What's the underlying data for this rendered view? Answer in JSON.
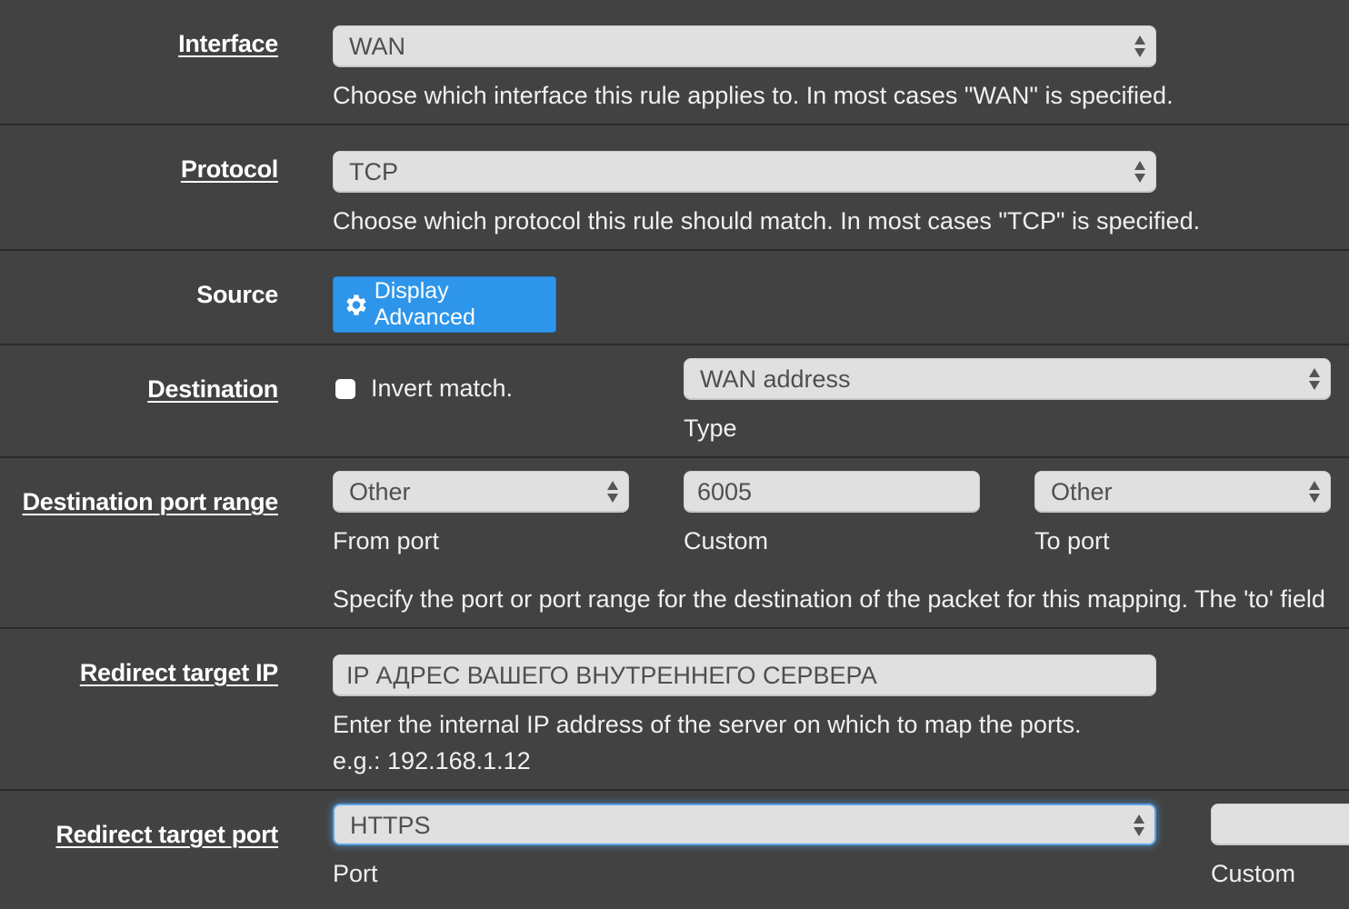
{
  "interface": {
    "label": "Interface",
    "value": "WAN",
    "help": "Choose which interface this rule applies to. In most cases \"WAN\" is specified."
  },
  "protocol": {
    "label": "Protocol",
    "value": "TCP",
    "help": "Choose which protocol this rule should match. In most cases \"TCP\" is specified."
  },
  "source": {
    "label": "Source",
    "button_label": "Display Advanced",
    "button_icon": "gear-icon",
    "button_color": "#2e96ea"
  },
  "destination": {
    "label": "Destination",
    "invert_label": "Invert match.",
    "invert_checked": false,
    "type_value": "WAN address",
    "type_caption": "Type"
  },
  "dest_port_range": {
    "label": "Destination port range",
    "from_value": "Other",
    "from_caption": "From port",
    "custom_value": "6005",
    "custom_caption": "Custom",
    "to_value": "Other",
    "to_caption": "To port",
    "help": "Specify the port or port range for the destination of the packet for this mapping. The 'to' field"
  },
  "redirect_ip": {
    "label": "Redirect target IP",
    "value": "IP АДРЕС ВАШЕГО ВНУТРЕННЕГО СЕРВЕРА",
    "help": "Enter the internal IP address of the server on which to map the ports.",
    "example": "e.g.: 192.168.1.12"
  },
  "redirect_port": {
    "label": "Redirect target port",
    "value": "HTTPS",
    "caption": "Port",
    "custom_value": "",
    "custom_caption": "Custom"
  }
}
